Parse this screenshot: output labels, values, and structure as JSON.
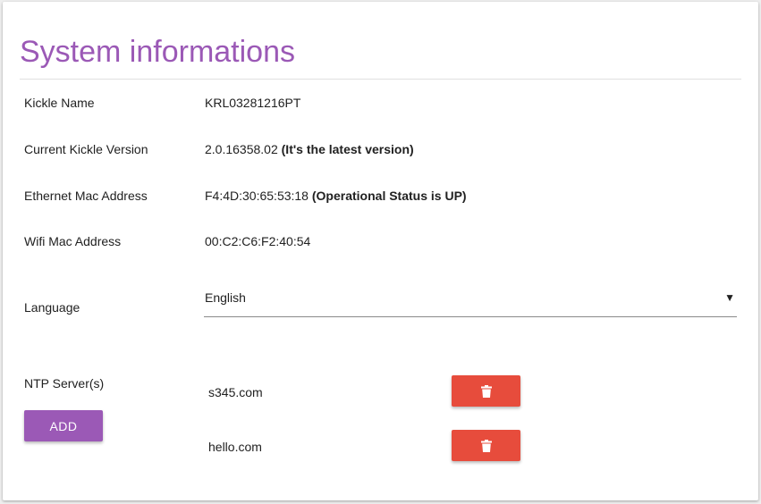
{
  "title": "System informations",
  "info": {
    "kickle_name": {
      "label": "Kickle Name",
      "value": "KRL03281216PT"
    },
    "version": {
      "label": "Current Kickle Version",
      "value": "2.0.16358.02",
      "status": "(It's the latest version)"
    },
    "ethernet": {
      "label": "Ethernet Mac Address",
      "value": "F4:4D:30:65:53:18",
      "status": "(Operational Status is UP)"
    },
    "wifi": {
      "label": "Wifi Mac Address",
      "value": "00:C2:C6:F2:40:54"
    }
  },
  "language": {
    "label": "Language",
    "selected": "English",
    "arrow": "▼"
  },
  "ntp": {
    "label": "NTP Server(s)",
    "add_label": "ADD",
    "servers": [
      {
        "host": "s345.com"
      },
      {
        "host": "hello.com"
      }
    ]
  },
  "colors": {
    "accent": "#9b59b6",
    "danger": "#e74c3c"
  },
  "icons": {
    "delete": "trash-icon"
  }
}
